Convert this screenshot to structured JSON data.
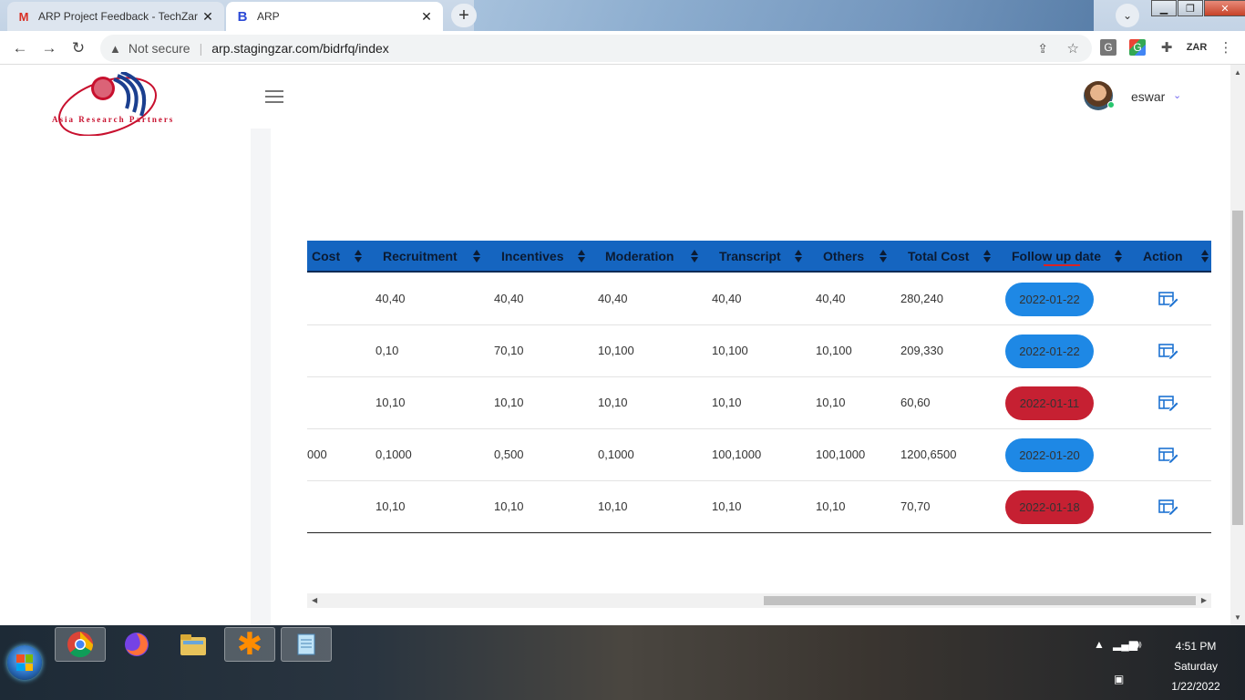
{
  "browser": {
    "tabs": [
      {
        "title": "ARP Project Feedback - TechZar",
        "favicon": "gmail-icon"
      },
      {
        "title": "ARP",
        "favicon": "b-icon"
      }
    ],
    "security_label": "Not secure",
    "url": "arp.stagingzar.com/bidrfq/index"
  },
  "header": {
    "logo_text": "Asia Research Partners",
    "username": "eswar"
  },
  "table": {
    "columns": [
      "Cost",
      "Recruitment",
      "Incentives",
      "Moderation",
      "Transcript",
      "Others",
      "Total Cost",
      "Follow up date",
      "Action"
    ],
    "rows": [
      {
        "cost": "",
        "recruitment": "40,40",
        "incentives": "40,40",
        "moderation": "40,40",
        "transcript": "40,40",
        "others": "40,40",
        "total_cost": "280,240",
        "follow_up": "2022-01-22",
        "status": "blue"
      },
      {
        "cost": "",
        "recruitment": "0,10",
        "incentives": "70,10",
        "moderation": "10,100",
        "transcript": "10,100",
        "others": "10,100",
        "total_cost": "209,330",
        "follow_up": "2022-01-22",
        "status": "blue"
      },
      {
        "cost": "",
        "recruitment": "10,10",
        "incentives": "10,10",
        "moderation": "10,10",
        "transcript": "10,10",
        "others": "10,10",
        "total_cost": "60,60",
        "follow_up": "2022-01-11",
        "status": "red"
      },
      {
        "cost": "000",
        "recruitment": "0,1000",
        "incentives": "0,500",
        "moderation": "0,1000",
        "transcript": "100,1000",
        "others": "100,1000",
        "total_cost": "1200,6500",
        "follow_up": "2022-01-20",
        "status": "blue"
      },
      {
        "cost": "",
        "recruitment": "10,10",
        "incentives": "10,10",
        "moderation": "10,10",
        "transcript": "10,10",
        "others": "10,10",
        "total_cost": "70,70",
        "follow_up": "2022-01-18",
        "status": "red"
      }
    ]
  },
  "colors": {
    "header_bg": "#1565c0",
    "pill_blue": "#1e88e5",
    "pill_red": "#c62032",
    "action_icon": "#1e73d2"
  },
  "taskbar": {
    "apps": [
      "chrome-icon",
      "firefox-icon",
      "file-explorer-icon",
      "app-asterisk-icon",
      "notepad-icon"
    ],
    "time": "4:51 PM",
    "day": "Saturday",
    "date": "1/22/2022"
  }
}
